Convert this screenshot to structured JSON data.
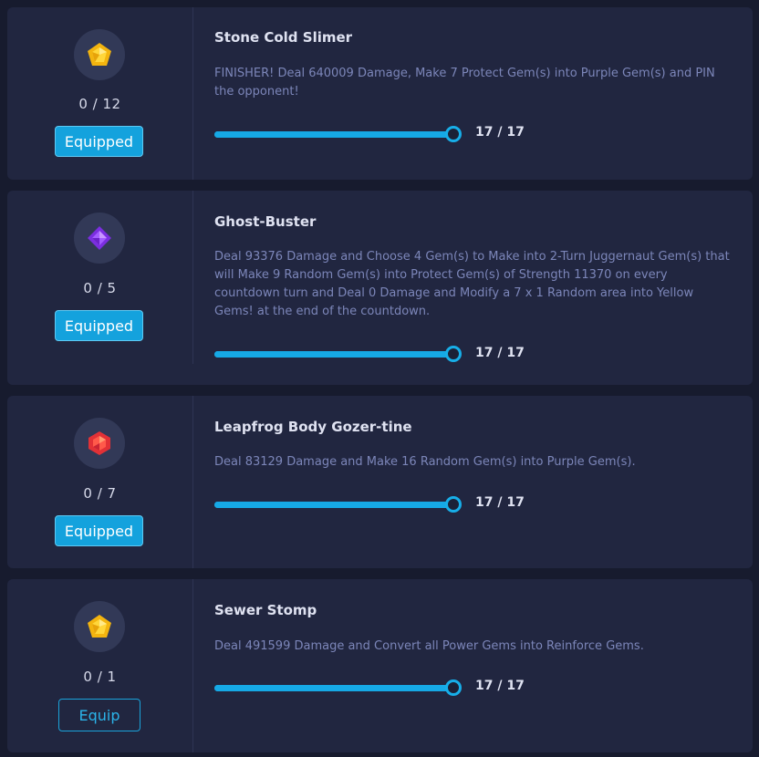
{
  "skills": [
    {
      "gem_icon": "yellow-gem-icon",
      "gem_color": "#f5c21a",
      "count": "0 / 12",
      "button_label": "Equipped",
      "button_state": "equipped",
      "title": "Stone Cold Slimer",
      "description": "FINISHER! Deal 640009 Damage, Make 7 Protect Gem(s) into Purple Gem(s) and PIN the opponent!",
      "level_value": 17,
      "level_max": 17,
      "level_text": "17 / 17"
    },
    {
      "gem_icon": "purple-gem-icon",
      "gem_color": "#8f3df0",
      "count": "0 / 5",
      "button_label": "Equipped",
      "button_state": "equipped",
      "title": "Ghost-Buster",
      "description": "Deal 93376 Damage and Choose 4 Gem(s) to Make into 2-Turn Juggernaut Gem(s) that will Make 9 Random Gem(s) into Protect Gem(s) of Strength 11370 on every countdown turn and Deal 0 Damage and Modify a 7 x 1 Random area into Yellow Gems! at the end of the countdown.",
      "level_value": 17,
      "level_max": 17,
      "level_text": "17 / 17"
    },
    {
      "gem_icon": "red-gem-icon",
      "gem_color": "#ea3d3a",
      "count": "0 / 7",
      "button_label": "Equipped",
      "button_state": "equipped",
      "title": "Leapfrog Body Gozer-tine",
      "description": "Deal 83129 Damage and Make 16 Random Gem(s) into Purple Gem(s).",
      "level_value": 17,
      "level_max": 17,
      "level_text": "17 / 17"
    },
    {
      "gem_icon": "yellow-gem-icon",
      "gem_color": "#f5c21a",
      "count": "0 / 1",
      "button_label": "Equip",
      "button_state": "equip",
      "title": "Sewer Stomp",
      "description": "Deal 491599 Damage and Convert all Power Gems into Reinforce Gems.",
      "level_value": 17,
      "level_max": 17,
      "level_text": "17 / 17"
    }
  ],
  "colors": {
    "background": "#171b2e",
    "card": "#212640",
    "accent": "#14a2dd",
    "description_text": "#7c86b9"
  }
}
